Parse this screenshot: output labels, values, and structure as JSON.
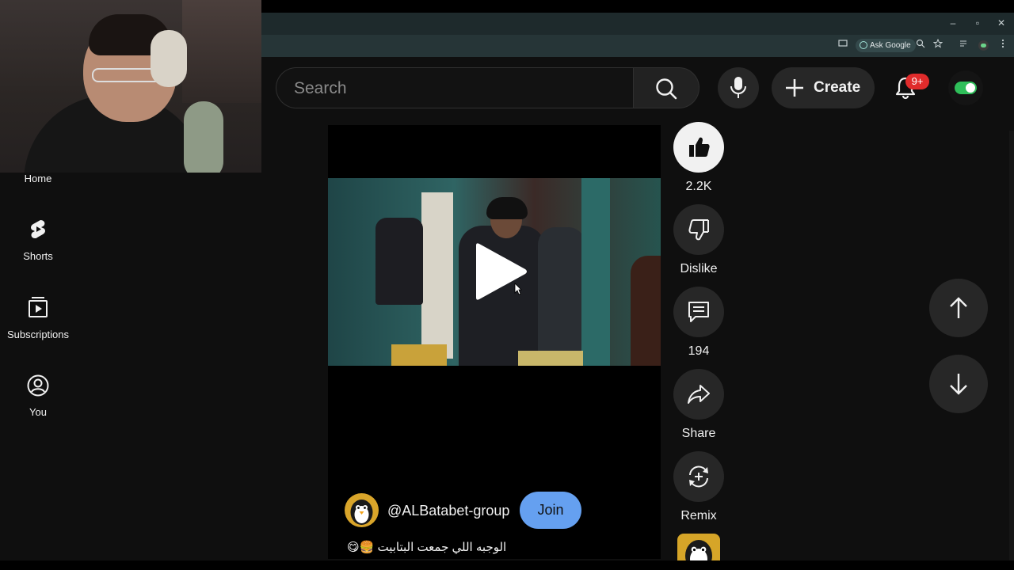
{
  "browser": {
    "window_controls": {
      "minimize": "–",
      "maximize": "▫",
      "close": "✕"
    },
    "toolbar": {
      "ask_google_label": "Ask Google"
    }
  },
  "header": {
    "search": {
      "placeholder": "Search",
      "value": ""
    },
    "create_label": "Create",
    "notifications_badge": "9+"
  },
  "sidebar": {
    "items": [
      {
        "label": "Home",
        "icon": "home-icon"
      },
      {
        "label": "Shorts",
        "icon": "shorts-icon"
      },
      {
        "label": "Subscriptions",
        "icon": "subscriptions-icon"
      },
      {
        "label": "You",
        "icon": "you-icon"
      }
    ]
  },
  "video": {
    "channel_handle": "@ALBatabet-group",
    "join_label": "Join",
    "caption": "الوجبه اللي جمعت البتابيت 🍔😋"
  },
  "actions": {
    "like_count": "2.2K",
    "dislike_label": "Dislike",
    "comment_count": "194",
    "share_label": "Share",
    "remix_label": "Remix"
  },
  "colors": {
    "background": "#0f0f0f",
    "surface": "#272727",
    "join_button": "#65a0f0",
    "badge": "#e02b2b",
    "browser_toolbar": "#263537"
  }
}
